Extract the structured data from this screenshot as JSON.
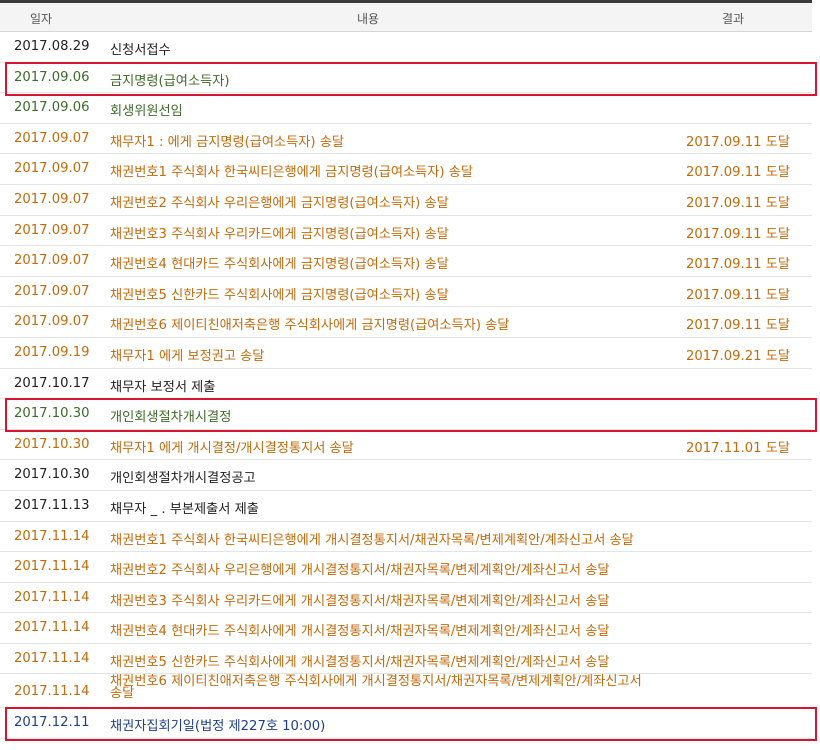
{
  "header": {
    "date": "일자",
    "content": "내용",
    "result": "결과"
  },
  "colors": {
    "black": "#222222",
    "green": "#3d6b2a",
    "orange": "#c26a0c",
    "blue": "#1f3f88",
    "highlight": "#d9142e"
  },
  "rows": [
    {
      "date": "2017.08.29",
      "content": "신청서접수",
      "result": "",
      "color": "black"
    },
    {
      "date": "2017.09.06",
      "content": "금지명령(급여소득자)",
      "result": "",
      "color": "green",
      "highlighted": true
    },
    {
      "date": "2017.09.06",
      "content": "회생위원선임",
      "result": "",
      "color": "green"
    },
    {
      "date": "2017.09.07",
      "content": "채무자1 :        에게 금지명령(급여소득자) 송달",
      "result": "2017.09.11 도달",
      "color": "orange"
    },
    {
      "date": "2017.09.07",
      "content": "채권번호1 주식회사 한국씨티은행에게 금지명령(급여소득자) 송달",
      "result": "2017.09.11 도달",
      "color": "orange"
    },
    {
      "date": "2017.09.07",
      "content": "채권번호2 주식회사 우리은행에게 금지명령(급여소득자) 송달",
      "result": "2017.09.11 도달",
      "color": "orange"
    },
    {
      "date": "2017.09.07",
      "content": "채권번호3 주식회사 우리카드에게 금지명령(급여소득자) 송달",
      "result": "2017.09.11 도달",
      "color": "orange"
    },
    {
      "date": "2017.09.07",
      "content": "채권번호4 현대카드 주식회사에게 금지명령(급여소득자) 송달",
      "result": "2017.09.11 도달",
      "color": "orange"
    },
    {
      "date": "2017.09.07",
      "content": "채권번호5 신한카드 주식회사에게 금지명령(급여소득자) 송달",
      "result": "2017.09.11 도달",
      "color": "orange"
    },
    {
      "date": "2017.09.07",
      "content": "채권번호6 제이티친애저축은행 주식회사에게 금지명령(급여소득자) 송달",
      "result": "2017.09.11 도달",
      "color": "orange"
    },
    {
      "date": "2017.09.19",
      "content": "채무자1          에게 보정권고 송달",
      "result": "2017.09.21 도달",
      "color": "orange"
    },
    {
      "date": "2017.10.17",
      "content": "채무자           보정서 제출",
      "result": "",
      "color": "black"
    },
    {
      "date": "2017.10.30",
      "content": "개인회생절차개시결정",
      "result": "",
      "color": "green",
      "highlighted": true
    },
    {
      "date": "2017.10.30",
      "content": "채무자1          에게 개시결정/개시결정통지서 송달",
      "result": "2017.11.01 도달",
      "color": "orange"
    },
    {
      "date": "2017.10.30",
      "content": "개인회생절차개시결정공고",
      "result": "",
      "color": "black"
    },
    {
      "date": "2017.11.13",
      "content": "채무자  _     .  부본제출서 제출",
      "result": "",
      "color": "black"
    },
    {
      "date": "2017.11.14",
      "content": "채권번호1 주식회사 한국씨티은행에게 개시결정통지서/채권자목록/변제계획안/계좌신고서 송달",
      "result": "",
      "color": "orange"
    },
    {
      "date": "2017.11.14",
      "content": "채권번호2 주식회사 우리은행에게 개시결정통지서/채권자목록/변제계획안/계좌신고서 송달",
      "result": "",
      "color": "orange"
    },
    {
      "date": "2017.11.14",
      "content": "채권번호3 주식회사 우리카드에게 개시결정통지서/채권자목록/변제계획안/계좌신고서 송달",
      "result": "",
      "color": "orange"
    },
    {
      "date": "2017.11.14",
      "content": "채권번호4 현대카드 주식회사에게 개시결정통지서/채권자목록/변제계획안/계좌신고서 송달",
      "result": "",
      "color": "orange"
    },
    {
      "date": "2017.11.14",
      "content": "채권번호5 신한카드 주식회사에게 개시결정통지서/채권자목록/변제계획안/계좌신고서 송달",
      "result": "",
      "color": "orange"
    },
    {
      "date": "2017.11.14",
      "content": "채권번호6 제이티친애저축은행 주식회사에게 개시결정통지서/채권자목록/변제계획안/계좌신고서 송달",
      "result": "",
      "color": "orange",
      "tall": true
    },
    {
      "date": "2017.12.11",
      "content": "채권자집회기일(법정 제227호 10:00)",
      "result": "",
      "color": "blue",
      "highlighted": true
    }
  ]
}
